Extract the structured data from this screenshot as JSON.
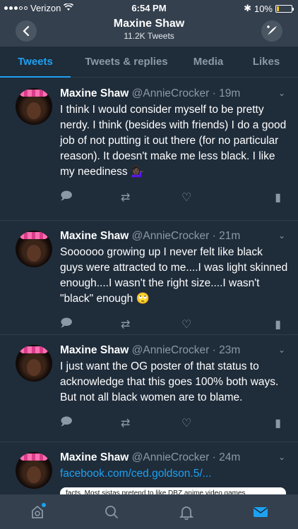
{
  "statusbar": {
    "carrier": "Verizon",
    "time": "6:54 PM",
    "battery": "10%"
  },
  "header": {
    "title": "Maxine Shaw",
    "subtitle": "11.2K Tweets",
    "back_icon": "back-arrow-icon",
    "compose_icon": "compose-icon"
  },
  "tabs": [
    {
      "label": "Tweets",
      "active": true
    },
    {
      "label": "Tweets & replies",
      "active": false
    },
    {
      "label": "Media",
      "active": false
    },
    {
      "label": "Likes",
      "active": false
    }
  ],
  "tweets": [
    {
      "name": "Maxine Shaw",
      "handle": "@AnnieCrocker",
      "time": "· 19m",
      "text": "I think I would consider myself to be pretty nerdy. I think (besides with friends) I do a good job of not putting it out there (for no particular reason). It doesn't make me less black. I like my neediness 💁🏿‍♀️"
    },
    {
      "name": "Maxine Shaw",
      "handle": "@AnnieCrocker",
      "time": "· 21m",
      "text": "Soooooo growing up I never felt like black guys were attracted to me....I was light skinned enough....I wasn't the right size....I wasn't \"black\" enough 🙄"
    },
    {
      "name": "Maxine Shaw",
      "handle": "@AnnieCrocker",
      "time": "· 23m",
      "text": "I just want the OG poster of that status to acknowledge that this goes 100% both ways. But not all black women are to blame."
    },
    {
      "name": "Maxine Shaw",
      "handle": "@AnnieCrocker",
      "time": "· 24m",
      "link": "facebook.com/ced.goldson.5/...",
      "card_text": "facts. Most sistas pretend to like DBZ anime video games"
    }
  ],
  "icons": {
    "reply": "reply-icon",
    "retweet": "retweet-icon",
    "like": "heart-icon",
    "analytics": "analytics-icon"
  },
  "colors": {
    "accent": "#1da1f2",
    "background": "#1f2c3a",
    "header": "#34404e"
  }
}
